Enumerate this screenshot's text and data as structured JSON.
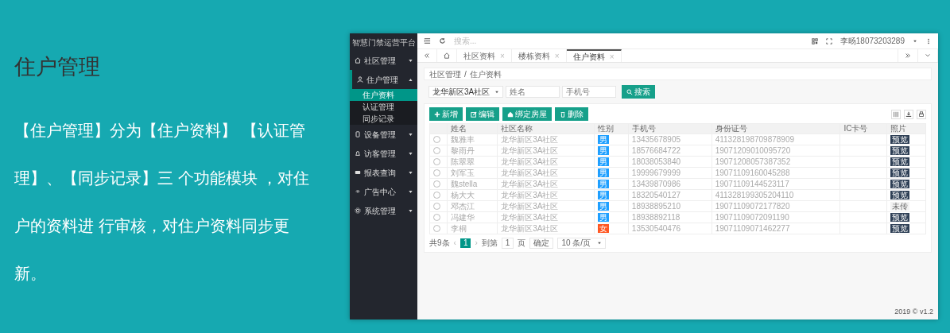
{
  "intro": {
    "title": "住户管理",
    "text": "【住户管理】分为【住户资料】 【认证管理】、【同步记录】三 个功能模块 ，对住户的资料进 行审核，对住户资料同步更新。"
  },
  "app": {
    "brand": "智慧门禁运营平台",
    "sidebar": {
      "items": [
        {
          "label": "社区管理",
          "expanded": false
        },
        {
          "label": "住户管理",
          "expanded": true,
          "children": [
            {
              "label": "住户资料",
              "selected": true
            },
            {
              "label": "认证管理",
              "selected": false
            },
            {
              "label": "同步记录",
              "selected": false
            }
          ]
        },
        {
          "label": "设备管理",
          "expanded": false
        },
        {
          "label": "访客管理",
          "expanded": false
        },
        {
          "label": "报表查询",
          "expanded": false
        },
        {
          "label": "广告中心",
          "expanded": false
        },
        {
          "label": "系统管理",
          "expanded": false
        }
      ]
    },
    "topbar": {
      "search_placeholder": "搜索...",
      "user": "李旸18073203289"
    },
    "tabs": [
      {
        "label": "社区资料",
        "close": "×",
        "selected": false
      },
      {
        "label": "楼栋资料",
        "close": "×",
        "selected": false
      },
      {
        "label": "住户资料",
        "close": "×",
        "selected": true
      }
    ],
    "breadcrumb": {
      "items": [
        "社区管理",
        "住户资料"
      ],
      "separator": "/"
    },
    "filters": {
      "community": "龙华新区3A社区",
      "name_placeholder": "姓名",
      "phone_placeholder": "手机号",
      "search_button": "搜索"
    },
    "actions": [
      "新增",
      "编辑",
      "绑定房屋",
      "删除"
    ],
    "table": {
      "columns": [
        "姓名",
        "社区名称",
        "性别",
        "手机号",
        "身份证号",
        "IC卡号",
        "照片"
      ],
      "rows": [
        {
          "selected": false,
          "name": "魏雅丰",
          "community": "龙华新区3A社区",
          "gender": {
            "text": "男",
            "color": "#1e9fff"
          },
          "phone": "13435678905",
          "id_number": "411328198709878909",
          "photo": {
            "text": "预览",
            "kind": "button"
          }
        },
        {
          "selected": false,
          "name": "黎雨丹",
          "community": "龙华新区3A社区",
          "gender": {
            "text": "男",
            "color": "#1e9fff"
          },
          "phone": "18576684722",
          "id_number": "19071209010095720",
          "photo": {
            "text": "预览",
            "kind": "button"
          }
        },
        {
          "selected": false,
          "name": "陈翠翠",
          "community": "龙华新区3A社区",
          "gender": {
            "text": "男",
            "color": "#1e9fff"
          },
          "phone": "18038053840",
          "id_number": "19071208057387352",
          "photo": {
            "text": "预览",
            "kind": "button"
          }
        },
        {
          "selected": false,
          "name": "刘军玉",
          "community": "龙华新区3A社区",
          "gender": {
            "text": "男",
            "color": "#1e9fff"
          },
          "phone": "19999679999",
          "id_number": "19071109160045288",
          "photo": {
            "text": "预览",
            "kind": "button"
          }
        },
        {
          "selected": false,
          "name": "魏stella",
          "community": "龙华新区3A社区",
          "gender": {
            "text": "男",
            "color": "#1e9fff"
          },
          "phone": "13439870986",
          "id_number": "19071109144523117",
          "photo": {
            "text": "预览",
            "kind": "button"
          }
        },
        {
          "selected": false,
          "name": "杨大大",
          "community": "龙华新区3A社区",
          "gender": {
            "text": "男",
            "color": "#1e9fff"
          },
          "phone": "18320540127",
          "id_number": "411328199305204110",
          "photo": {
            "text": "预览",
            "kind": "button"
          }
        },
        {
          "selected": false,
          "name": "邓杰江",
          "community": "龙华新区3A社区",
          "gender": {
            "text": "男",
            "color": "#1e9fff"
          },
          "phone": "18938895210",
          "id_number": "19071109072177820",
          "photo": {
            "text": "未传",
            "kind": "status"
          }
        },
        {
          "selected": false,
          "name": "冯建华",
          "community": "龙华新区3A社区",
          "gender": {
            "text": "男",
            "color": "#1e9fff"
          },
          "phone": "18938892118",
          "id_number": "19071109072091190",
          "photo": {
            "text": "预览",
            "kind": "button"
          }
        },
        {
          "selected": false,
          "name": "李桐",
          "community": "龙华新区3A社区",
          "gender": {
            "text": "女",
            "color": "#ff5722"
          },
          "phone": "13530540476",
          "id_number": "19071109071462277",
          "photo": {
            "text": "预览",
            "kind": "button"
          }
        }
      ]
    },
    "pagination": {
      "total": "共9条",
      "prev": "‹",
      "page": "1",
      "next": "›",
      "goto": "到第",
      "goto_value": "1",
      "page_unit": "页",
      "confirm": "确定",
      "page_size": "10 条/页"
    },
    "footer": "2019 © v1.2"
  }
}
